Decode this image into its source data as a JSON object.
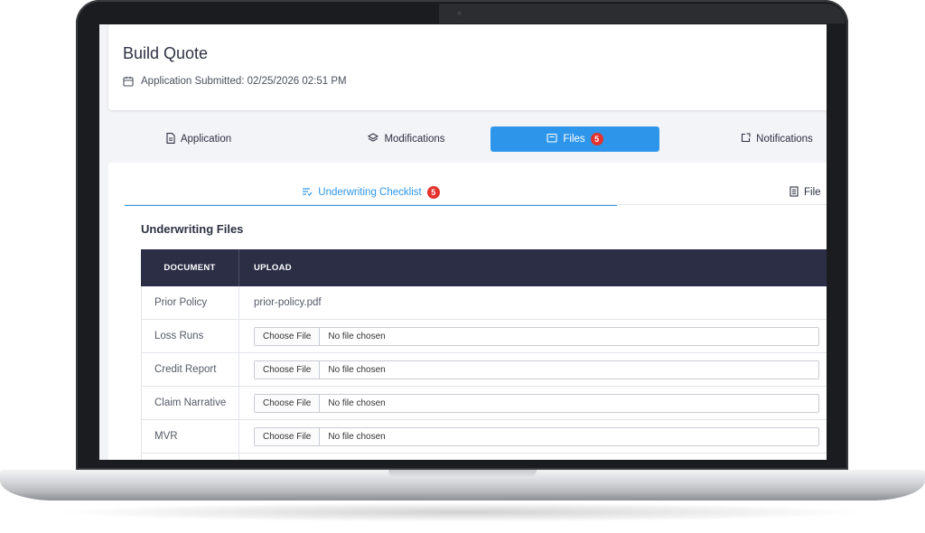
{
  "header": {
    "title": "Build Quote",
    "submitted": "Application Submitted: 02/25/2026 02:51 PM"
  },
  "main_tabs": [
    {
      "label": "Application",
      "icon": "document-icon"
    },
    {
      "label": "Modifications",
      "icon": "layers-icon"
    },
    {
      "label": "Files",
      "icon": "folder-icon",
      "badge": "5",
      "active": true
    },
    {
      "label": "Notifications",
      "icon": "external-link-icon"
    }
  ],
  "sub_tabs": [
    {
      "label": "Underwriting Checklist",
      "icon": "checklist-icon",
      "badge": "5",
      "active": true
    },
    {
      "label": "File",
      "icon": "file-icon"
    }
  ],
  "section_title": "Underwriting Files",
  "table": {
    "headers": [
      "DOCUMENT",
      "UPLOAD"
    ],
    "rows": [
      {
        "document": "Prior Policy",
        "upload": "prior-policy.pdf"
      },
      {
        "document": "Loss Runs",
        "button": "Choose File",
        "status": "No file chosen"
      },
      {
        "document": "Credit Report",
        "button": "Choose File",
        "status": "No file chosen"
      },
      {
        "document": "Claim Narrative",
        "button": "Choose File",
        "status": "No file chosen"
      },
      {
        "document": "MVR",
        "button": "Choose File",
        "status": "No file chosen"
      }
    ]
  },
  "colors": {
    "accent": "#2e96ea",
    "badge": "#e5322d",
    "table_header": "#2b2e45"
  }
}
